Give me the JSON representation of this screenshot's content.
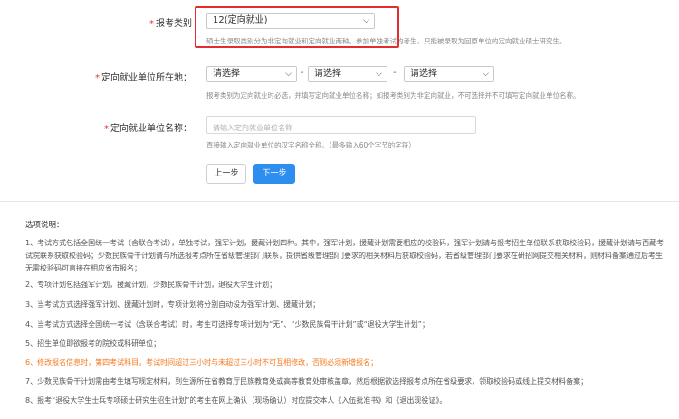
{
  "form": {
    "exam_category": {
      "label": "报考类别",
      "value": "12(定向就业)",
      "hint": "硕士生录取类别分为非定向就业和定向就业两种。参加单独考试的考生，只能被录取为回原单位的定向就业硕士研究生。"
    },
    "unit_location": {
      "label": "定向就业单位所在地：",
      "province": "请选择",
      "city": "请选择",
      "district": "请选择",
      "separator": "-",
      "hint": "报考类别为定向就业时必选，并填写定向就业单位名称；如报考类别为非定向就业，不可选择并不可填写定向就业单位名称。"
    },
    "unit_name": {
      "label": "定向就业单位名称：",
      "placeholder": "请输入定向就业单位名称",
      "hint": "直接输入定向就业单位的汉字名称全称。（最多输入60个字节的字符）"
    },
    "required_mark": "*",
    "buttons": {
      "prev": "上一步",
      "next": "下一步"
    }
  },
  "notes": {
    "title": "选项说明：",
    "items": [
      "1、考试方式包括全国统一考试（含联合考试），单独考试，强军计划，援藏计划四种。其中，强军计划，援藏计划需要相应的校验码，强军计划请与报考招生单位联系获取校验码，援藏计划请与西藏考试院联系获取校验码；少数民族骨干计划请与所选报考点所在省级管理部门联系，提供省级管理部门要求的相关材料后获取校验码，若省级管理部门要求在研招网提交相关材料，则材料备案通过后考生无需校验码可直接在相应省市报名；",
      "2、专项计划包括强军计划，援藏计划，少数民族骨干计划，退役大学生计划；",
      "3、当考试方式选择强军计划、援藏计划时，专项计划将分别自动设为强军计划、援藏计划；",
      "4、当考试方式选择全国统一考试（含联合考试）时，考生可选择专项计划为“无”、“少数民族骨干计划”或“退役大学生计划”；",
      "5、招生单位即欲报考的院校或科研单位；",
      "6、修改报名信息时，第四考试科目，考试时间超过三小时与未超过三小时不可互相修改，否则必须新增报名；",
      "7、少数民族骨干计划需由考生填写规定材料，到生源所在省教育厅民族教育处或高等教育处审核盖章，然后根据欲选择报考点所在省级要求，领取校验码或线上提交材料备案；",
      "8、报考“退役大学生士兵专项硕士研究生招生计划”的考生在网上确认（现场确认）时应提交本人《入伍批准书》和《退出现役证》。"
    ]
  },
  "colors": {
    "primary": "#2e8ef0",
    "required": "#e4393c",
    "warning": "#f47920",
    "highlight": "#e52b2b"
  }
}
